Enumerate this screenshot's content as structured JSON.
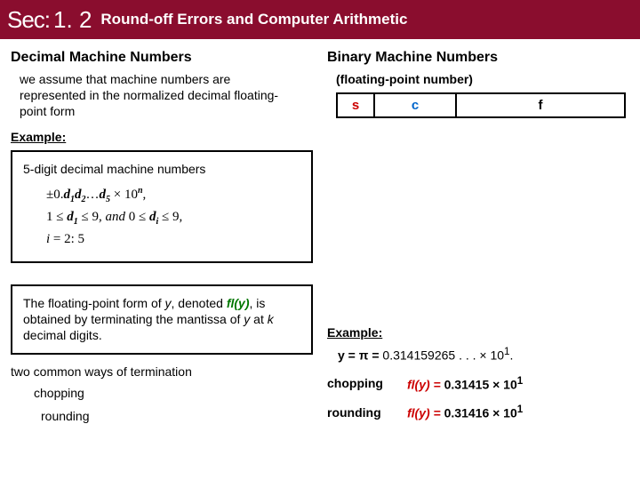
{
  "title": {
    "sec": "Sec:",
    "num": "1. 2",
    "name": "Round-off Errors and Computer Arithmetic"
  },
  "left": {
    "heading": "Decimal Machine Numbers",
    "intro": "we assume that machine numbers are represented in the normalized decimal floating-point form",
    "example_label": "Example:",
    "box1": {
      "title": "5-digit decimal machine numbers",
      "line1_pre": "±0.",
      "line1_d": "d",
      "line1_mid": "…",
      "line1_tail": " × 10",
      "line1_n": "n",
      "line2_a": "1 ≤ ",
      "line2_d1": "d",
      "line2_b": " ≤ 9,",
      "line2_and": " and ",
      "line2_c": "0 ≤ ",
      "line2_di": "d",
      "line2_e": " ≤ 9,",
      "line3": "i",
      "line3b": " = 2: 5"
    },
    "box2": {
      "text_a": "The floating-point form of ",
      "y": "y",
      "text_b": ", denoted ",
      "fl": "fl(y)",
      "text_c": ", is obtained by terminating the mantissa of ",
      "y2": "y",
      "text_d": " at ",
      "k": "k",
      "text_e": " decimal digits."
    },
    "termination": "two common ways of termination",
    "m1": "chopping",
    "m2": "rounding"
  },
  "right": {
    "heading": "Binary Machine Numbers",
    "sub": "(floating-point number)",
    "s": "s",
    "c": "c",
    "f": "f",
    "example_label": "Example:",
    "y_eq": "y = π = ",
    "pi_val": "0.314159265 . . . × 10",
    "exp1": "1",
    "dot": ".",
    "m1": "chopping",
    "fl1": "fl(y) = ",
    "v1": "0.31415 × 10",
    "e1": "1",
    "m2": "rounding",
    "fl2": "fl(y) = ",
    "v2": "0.31416 × 10",
    "e2": "1"
  }
}
